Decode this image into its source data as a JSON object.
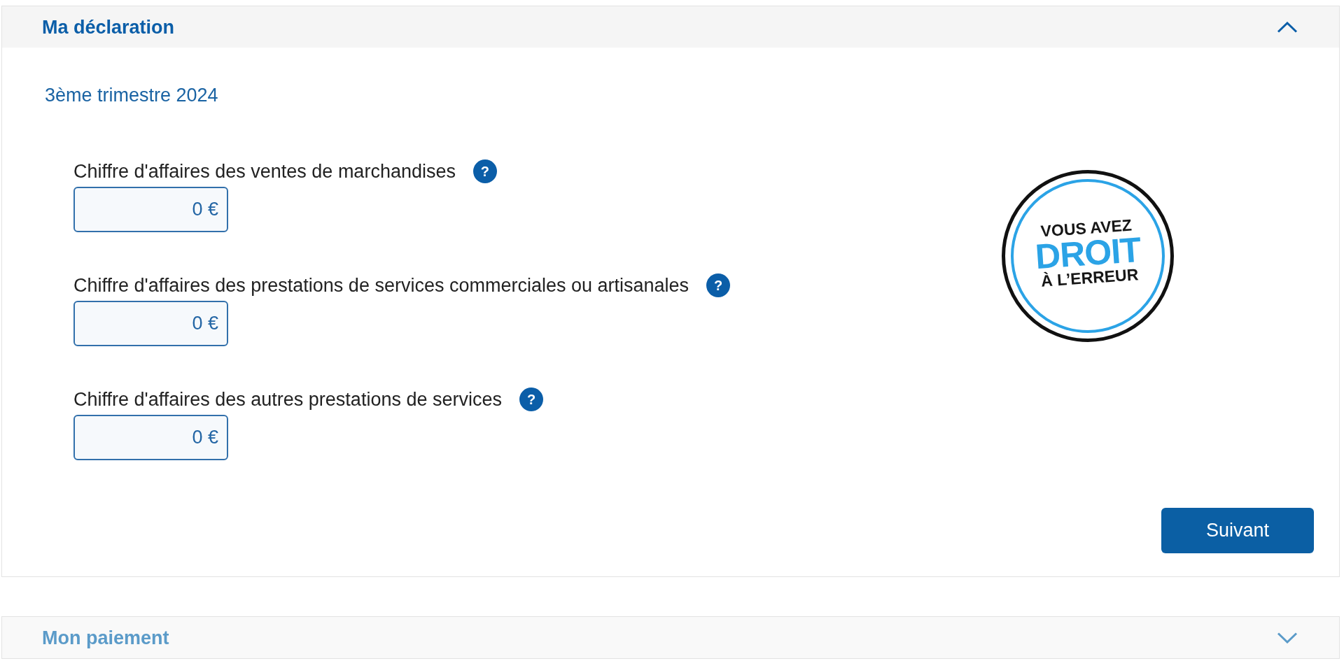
{
  "sections": [
    {
      "title": "Ma déclaration",
      "expanded": true,
      "disabled": false,
      "period": "3ème trimestre 2024",
      "fields": [
        {
          "label": "Chiffre d'affaires des ventes de marchandises",
          "help": "?",
          "value": "0 €"
        },
        {
          "label": "Chiffre d'affaires des prestations de services commerciales ou artisanales",
          "help": "?",
          "value": "0 €"
        },
        {
          "label": "Chiffre d'affaires des autres prestations de services",
          "help": "?",
          "value": "0 €"
        }
      ],
      "badge": {
        "top": "VOUS AVEZ",
        "main": "DROIT",
        "bottom": "À L’ERREUR"
      },
      "button": "Suivant"
    },
    {
      "title": "Mon paiement",
      "expanded": false,
      "disabled": true
    }
  ]
}
